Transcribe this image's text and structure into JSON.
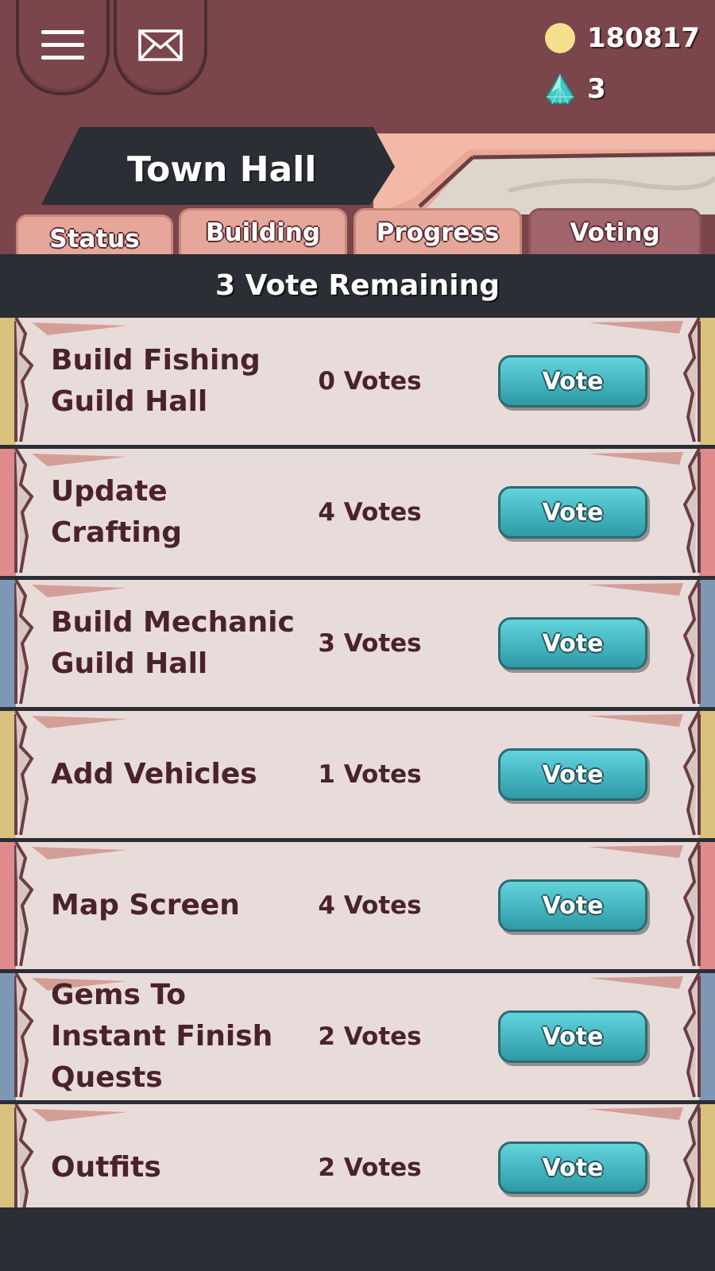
{
  "header": {
    "currency": {
      "coins": "180817",
      "gems": "3"
    },
    "title": "Town Hall"
  },
  "tabs": [
    {
      "label": "Status",
      "active": false
    },
    {
      "label": "Building",
      "active": false
    },
    {
      "label": "Progress",
      "active": false
    },
    {
      "label": "Voting",
      "active": true
    }
  ],
  "remaining_text": "3 Vote Remaining",
  "vote_button_label": "Vote",
  "vote_items": [
    {
      "title": "Build Fishing Guild Hall",
      "votes": "0 Votes",
      "accent": "#d9c27e"
    },
    {
      "title": "Update Crafting",
      "votes": "4 Votes",
      "accent": "#e08a8c"
    },
    {
      "title": "Build Mechanic Guild Hall",
      "votes": "3 Votes",
      "accent": "#7e97b4"
    },
    {
      "title": "Add Vehicles",
      "votes": "1 Votes",
      "accent": "#d9c27e"
    },
    {
      "title": "Map Screen",
      "votes": "4 Votes",
      "accent": "#e08a8c"
    },
    {
      "title": "Gems To Instant Finish Quests",
      "votes": "2 Votes",
      "accent": "#7e97b4"
    },
    {
      "title": "Outfits",
      "votes": "2 Votes",
      "accent": "#d9c27e"
    }
  ],
  "colors": {
    "header_bg": "#7a454b",
    "dark_bar": "#2b2e34",
    "card_bg": "#e8dcda",
    "button_teal": "#44b5bf",
    "text_dark": "#4a2328"
  },
  "icons": [
    "hamburger-menu-icon",
    "mail-envelope-icon",
    "gold-coin-icon",
    "gem-icon"
  ]
}
